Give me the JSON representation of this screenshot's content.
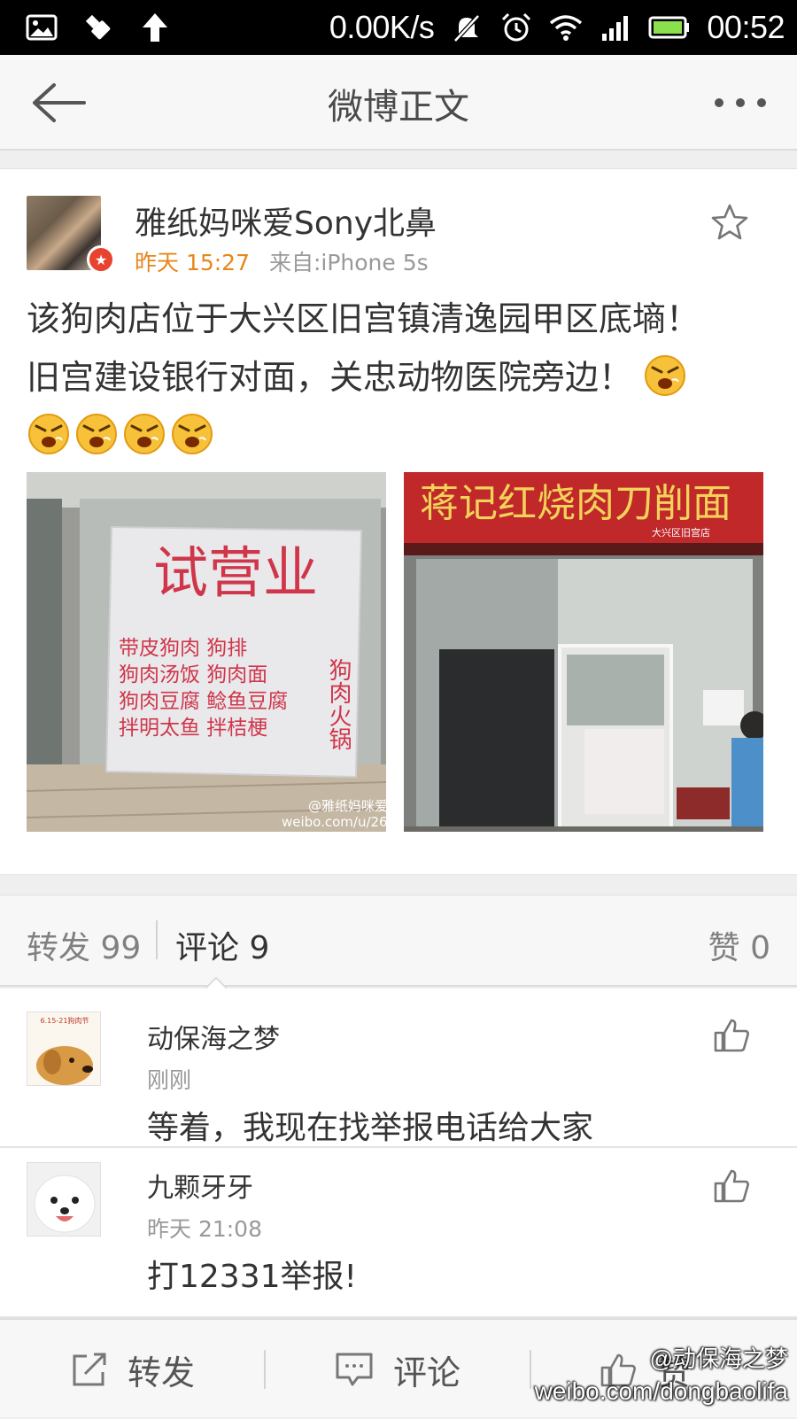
{
  "status_bar": {
    "speed": "0.00K/s",
    "time": "00:52",
    "icons": [
      "image-icon",
      "usb-icon",
      "upload-arrow-icon",
      "mute-icon",
      "alarm-icon",
      "wifi-icon",
      "signal-icon",
      "battery-icon"
    ]
  },
  "title_bar": {
    "title": "微博正文"
  },
  "post": {
    "username": "雅纸妈咪爱Sony北鼻",
    "time": "昨天 15:27",
    "source": "来自:iPhone 5s",
    "text": "该狗肉店位于大兴区旧宫镇清逸园甲区底墒！旧宫建设银行对面，关忠动物医院旁边！",
    "emoji_count": 5,
    "photo1": {
      "sign_title": "试营业",
      "sign_menu": [
        "带皮狗肉 狗排",
        "狗肉汤饭 狗肉面",
        "狗肉豆腐 鲶鱼豆腐",
        "拌明太鱼 拌桔梗"
      ],
      "sign_side": "狗肉火锅",
      "watermark": "@雅纸妈咪爱",
      "watermark_url": "weibo.com/u/26"
    },
    "photo2": {
      "shop_sign": "蒋记红烧肉刀削面",
      "shop_sub": "大兴区旧宫店"
    }
  },
  "counts": {
    "repost": "转发 99",
    "comment": "评论 9",
    "like": "赞 0"
  },
  "comments": [
    {
      "name": "动保海之梦",
      "time": "刚刚",
      "text": "等着，我现在找举报电话给大家",
      "avatar_text": "6.15-21狗肉节"
    },
    {
      "name": "九颗牙牙",
      "time": "昨天 21:08",
      "text": "打12331举报!"
    }
  ],
  "bottom_bar": {
    "repost": "转发",
    "comment": "评论",
    "like": "赞"
  },
  "watermark": {
    "handle": "@动保海之梦",
    "url": "weibo.com/dongbaolifa"
  },
  "colors": {
    "time_orange": "#e8851b",
    "badge_red": "#e8432e",
    "text_dark": "#333333",
    "text_gray": "#999999"
  }
}
